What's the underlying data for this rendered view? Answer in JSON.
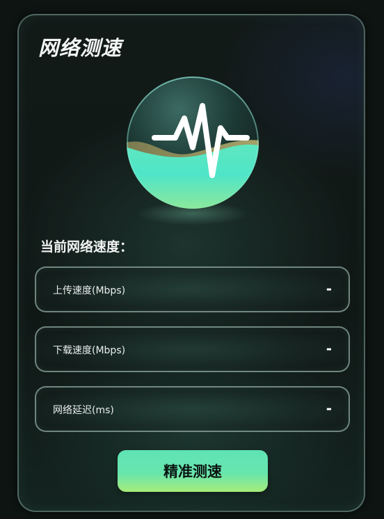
{
  "app": {
    "title": "网络测速"
  },
  "speed_section": {
    "label": "当前网络速度：",
    "metrics": [
      {
        "label": "上传速度(Mbps)",
        "value": "-"
      },
      {
        "label": "下载速度(Mbps)",
        "value": "-"
      },
      {
        "label": "网络延迟(ms)",
        "value": "-"
      }
    ]
  },
  "actions": {
    "test_label": "精准测速"
  },
  "icons": {
    "hero": "waveform-orb-icon"
  },
  "colors": {
    "accent": "#5fe3b4",
    "accent_secondary": "#a6ec7a",
    "background": "#0d1412"
  }
}
